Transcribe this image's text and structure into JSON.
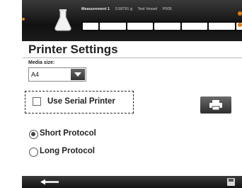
{
  "header": {
    "status_key": "Measurement 1",
    "status_value": "0.58791 g",
    "status_vessel_label": "Test Vessel",
    "status_vessel_value": "P005",
    "progress_segments": 7
  },
  "page": {
    "title": "Printer Settings"
  },
  "media": {
    "label": "Media size:",
    "selected": "A4"
  },
  "serial_printer": {
    "label": "Use Serial Printer",
    "checked": false
  },
  "protocol": {
    "options": [
      {
        "label": "Short Protocol",
        "selected": true
      },
      {
        "label": "Long Protocol",
        "selected": false
      }
    ]
  },
  "colors": {
    "accent": "#e07d16",
    "bar_dark": "#141414"
  },
  "icons": {
    "printer": "printer-icon",
    "back": "back-arrow-icon",
    "save": "save-icon",
    "flask": "flask-icon"
  }
}
